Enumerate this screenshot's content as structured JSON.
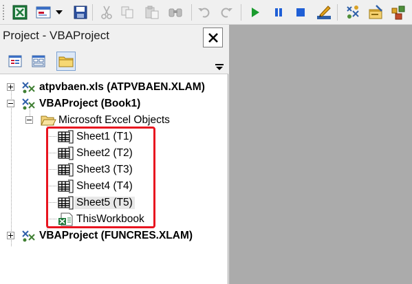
{
  "toolbar": {
    "buttons": [
      {
        "icon": "excel-view-icon"
      },
      {
        "icon": "insert-userform-icon"
      },
      {
        "icon": "dropdown-arrow-icon"
      },
      {
        "icon": "save-icon"
      },
      {
        "icon": "cut-icon"
      },
      {
        "icon": "copy-icon"
      },
      {
        "icon": "paste-icon"
      },
      {
        "icon": "find-icon"
      },
      {
        "icon": "undo-icon"
      },
      {
        "icon": "redo-icon"
      },
      {
        "icon": "run-icon"
      },
      {
        "icon": "break-icon"
      },
      {
        "icon": "reset-icon"
      },
      {
        "icon": "design-mode-icon"
      },
      {
        "icon": "project-explorer-icon"
      },
      {
        "icon": "properties-window-icon"
      },
      {
        "icon": "object-browser-icon"
      }
    ]
  },
  "project_pane": {
    "title": "Project - VBAProject",
    "close_label": "✕",
    "tree": {
      "items": [
        {
          "label": "atpvbaen.xls (ATPVBAEN.XLAM)",
          "bold": true,
          "expander": "+"
        },
        {
          "label": "VBAProject (Book1)",
          "bold": true,
          "expander": "−"
        },
        {
          "label": "Microsoft Excel Objects",
          "bold": false,
          "expander": "−"
        },
        {
          "label": "Sheet1 (T1)",
          "bold": false
        },
        {
          "label": "Sheet2 (T2)",
          "bold": false
        },
        {
          "label": "Sheet3 (T3)",
          "bold": false
        },
        {
          "label": "Sheet4 (T4)",
          "bold": false
        },
        {
          "label": "Sheet5 (T5)",
          "bold": false,
          "selected": true
        },
        {
          "label": "ThisWorkbook",
          "bold": false
        },
        {
          "label": "VBAProject (FUNCRES.XLAM)",
          "bold": true,
          "expander": "+"
        }
      ]
    }
  },
  "colors": {
    "highlight_border": "#e8141f",
    "workspace_bg": "#ababab",
    "run_green": "#1a9b2e",
    "stop_blue": "#1f5fd6"
  }
}
